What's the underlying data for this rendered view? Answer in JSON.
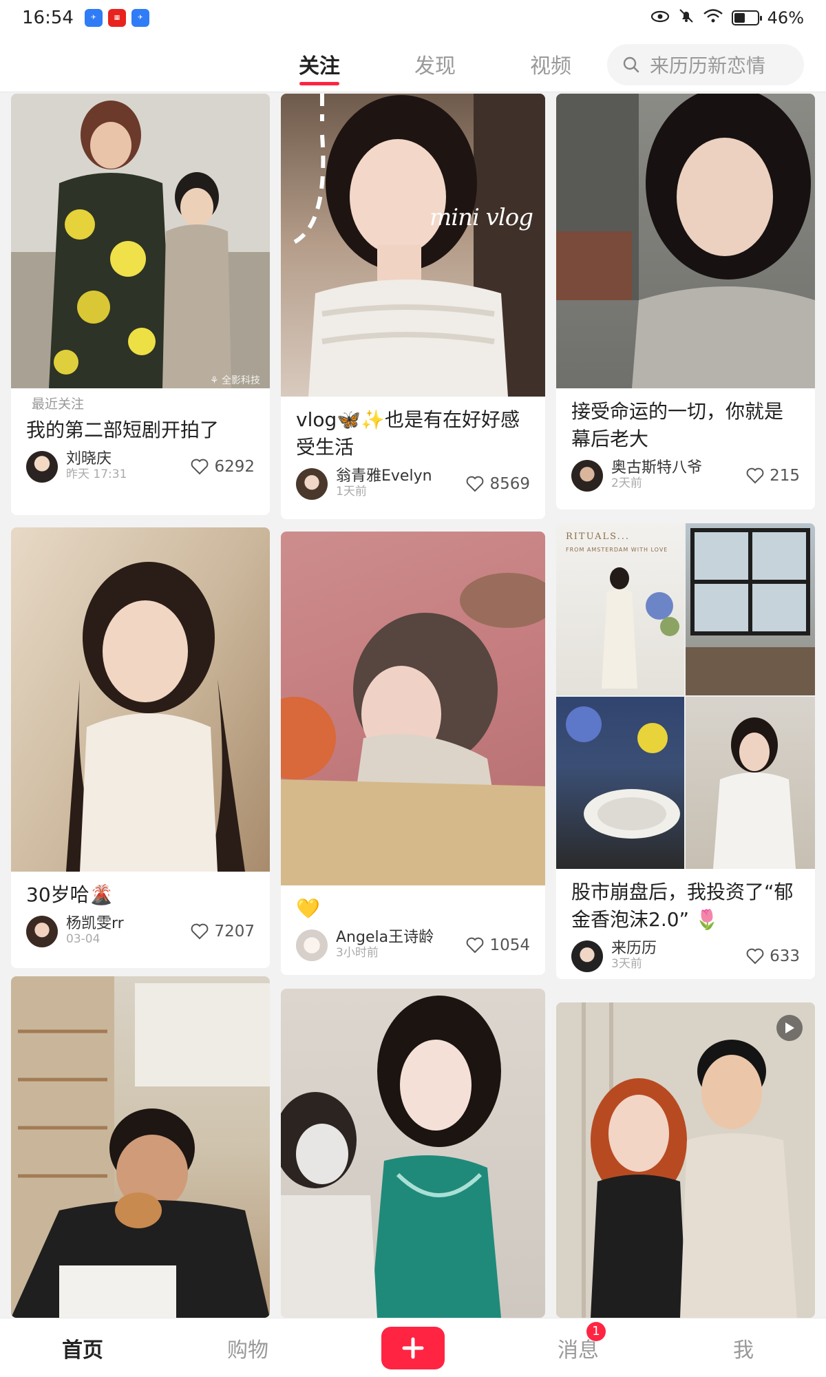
{
  "status_bar": {
    "time": "16:54",
    "battery": "46%",
    "battery_level": 0.46,
    "icons": [
      "app-notify-icon",
      "app-notify-icon",
      "app-notify-icon",
      "eye-icon",
      "mute-icon",
      "wifi-icon",
      "battery-icon"
    ]
  },
  "header": {
    "tabs": [
      "关注",
      "发现",
      "视频"
    ],
    "active_tab": 0,
    "search_placeholder": "来历历新恋情"
  },
  "feed": [
    {
      "label": "最近关注",
      "title": "我的第二部短剧开拍了",
      "author": "刘晓庆",
      "time": "昨天 17:31",
      "likes": "6292"
    },
    {
      "title": "vlog🦋✨也是有在好好感受生活",
      "overlay": "mini vlog",
      "author": "翁青雅Evelyn",
      "time": "1天前",
      "likes": "8569"
    },
    {
      "title": "接受命运的一切，你就是幕后老大",
      "author": "奥古斯特八爷",
      "time": "2天前",
      "likes": "215"
    },
    {
      "title": "30岁哈🌋",
      "author": "杨凯雯rr",
      "time": "03-04",
      "likes": "7207"
    },
    {
      "title": "💛",
      "author": "Angela王诗龄",
      "time": "3小时前",
      "likes": "1054"
    },
    {
      "title": "股市崩盘后，我投资了“郁金香泡沫2.0” 🌷",
      "author": "来历历",
      "time": "3天前",
      "likes": "633",
      "rituals_line1": "RITUALS...",
      "rituals_line2": "FROM AMSTERDAM WITH LOVE"
    },
    {
      "title": ""
    },
    {
      "title": ""
    },
    {
      "title": ""
    }
  ],
  "bottom_nav": {
    "items": [
      "首页",
      "购物",
      "",
      "消息",
      "我"
    ],
    "active": 0,
    "message_badge": "1"
  },
  "colors": {
    "accent": "#ff2442",
    "background": "#f2f2f2"
  }
}
